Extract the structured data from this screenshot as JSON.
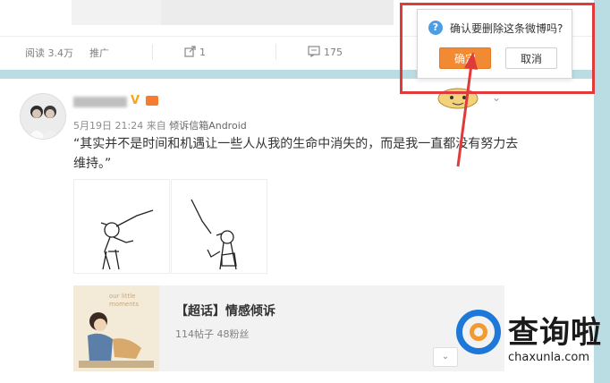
{
  "top_post": {
    "reads": "阅读 3.4万",
    "promote": "推广",
    "shares": "1",
    "comments": "175"
  },
  "post": {
    "meta_date": "5月19日 21:24 来自",
    "meta_source": "倾诉信箱Android",
    "content": "“其实并不是时间和机遇让一些人从我的生命中消失的，而是我一直都没有努力去维持。”",
    "topic": {
      "title": "【超话】情感倾诉",
      "stats": "114帖子 48粉丝",
      "image_text_lines": [
        "our little",
        "moments"
      ]
    }
  },
  "dialog": {
    "message": "确认要删除这条微博吗?",
    "confirm_label": "确定",
    "cancel_label": "取消"
  },
  "watermark": {
    "brand": "查询啦",
    "url": "chaxunla.com"
  },
  "colors": {
    "confirm_button": "#f28a33",
    "highlight_box": "#e03a3a",
    "page_background": "#b9dde2",
    "question_icon": "#4b9de4",
    "verified_badge": "#f7a51d"
  },
  "icons": [
    "share-icon",
    "comment-icon",
    "question-icon",
    "chevron-down-icon",
    "verified-badge-icon"
  ]
}
